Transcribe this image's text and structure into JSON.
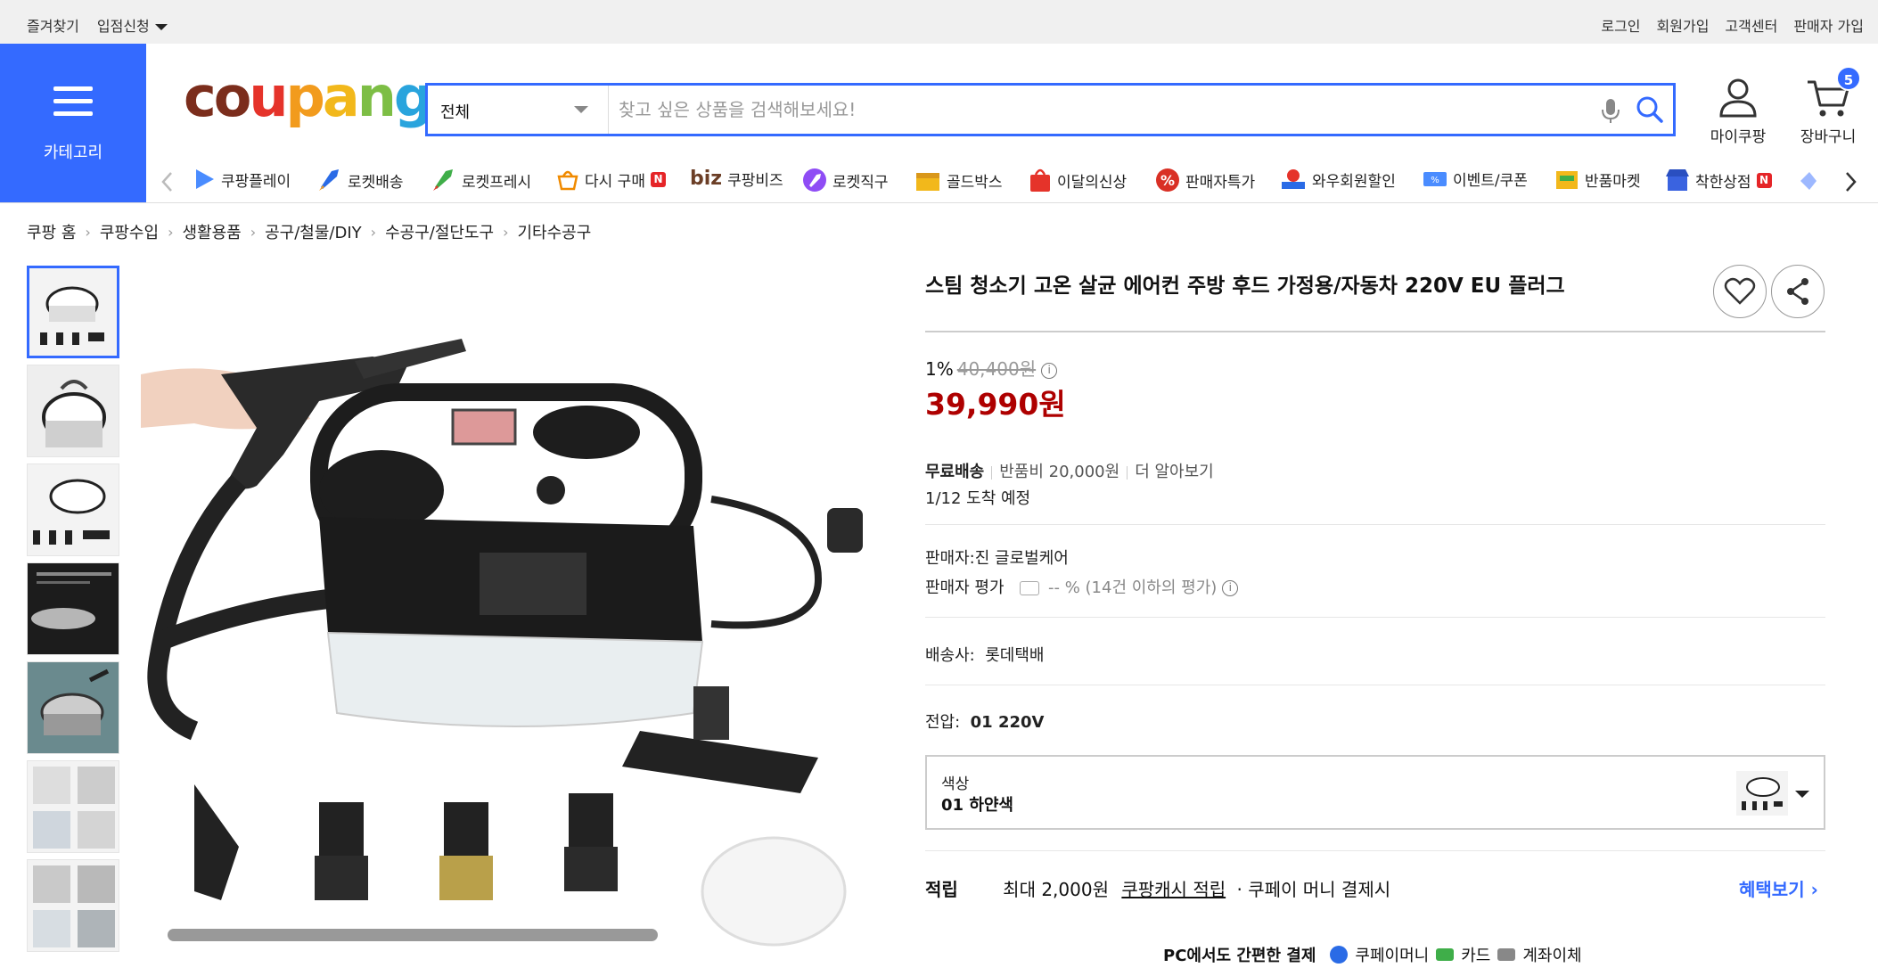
{
  "topbar": {
    "left": [
      "즐겨찾기",
      "입점신청"
    ],
    "right": [
      "로그인",
      "회원가입",
      "고객센터",
      "판매자 가입"
    ]
  },
  "category_button": {
    "label": "카테고리"
  },
  "logo": {
    "letters": [
      "c",
      "o",
      "u",
      "p",
      "a",
      "n",
      "g"
    ]
  },
  "search": {
    "category": "전체",
    "placeholder": "찾고 싶은 상품을 검색해보세요!"
  },
  "header_icons": {
    "mypage": "마이쿠팡",
    "cart": "장바구니",
    "cart_count": "5"
  },
  "nav": [
    {
      "label": "쿠팡플레이",
      "icon": "play-icon",
      "color": "#4a8cff"
    },
    {
      "label": "로켓배송",
      "icon": "rocket-icon",
      "color": "#2a6be6"
    },
    {
      "label": "로켓프레시",
      "icon": "rocket-fresh-icon",
      "color": "#3fae49"
    },
    {
      "label": "다시 구매",
      "icon": "basket-icon",
      "color": "#f08a00",
      "new": "N"
    },
    {
      "label": "쿠팡비즈",
      "icon": "biz-icon",
      "prefix": "biz",
      "color": "#6b3e26"
    },
    {
      "label": "로켓직구",
      "icon": "rocket-global-icon",
      "color": "#8f4cf5"
    },
    {
      "label": "골드박스",
      "icon": "goldbox-icon",
      "color": "#f2b81b"
    },
    {
      "label": "이달의신상",
      "icon": "shopping-bag-icon",
      "color": "#e5332a"
    },
    {
      "label": "판매자특가",
      "icon": "percent-icon",
      "color": "#d93025"
    },
    {
      "label": "와우회원할인",
      "icon": "wow-icon",
      "color": "#e5332a"
    },
    {
      "label": "이벤트/쿠폰",
      "icon": "coupon-icon",
      "color": "#4a8cff"
    },
    {
      "label": "반품마켓",
      "icon": "return-market-icon",
      "color": "#f2b81b"
    },
    {
      "label": "착한상점",
      "icon": "store-icon",
      "color": "#3a63e0",
      "new": "N"
    }
  ],
  "breadcrumb": [
    "쿠팡 홈",
    "쿠팡수입",
    "생활용품",
    "공구/철물/DIY",
    "수공구/절단도구",
    "기타수공구"
  ],
  "product": {
    "title": "스팀 청소기 고온 살균 에어컨 주방 후드 가정용/자동차 220V EU 플러그",
    "discount_rate": "1%",
    "original_price": "40,400원",
    "price": "39,990원",
    "shipping_label": "무료배송",
    "return_fee": "반품비 20,000원",
    "learn_more": "더 알아보기",
    "arrival": "1/12 도착 예정",
    "seller": "판매자:진 글로벌케어",
    "seller_rating_label": "판매자 평가",
    "seller_rating_value": "-- % (14건 이하의 평가)",
    "carrier_label": "배송사:",
    "carrier": "롯데택배",
    "voltage_label": "전압:",
    "voltage": "01 220V",
    "color_label": "색상",
    "color_value": "01 하얀색",
    "points_label": "적립",
    "points_text": "최대 2,000원",
    "points_link": "쿠팡캐시 적립",
    "points_suffix": "· 쿠페이 머니 결제시",
    "benefit_link": "혜택보기",
    "pay_title": "PC에서도 간편한 결제",
    "pay_methods": [
      "쿠페이머니",
      "카드",
      "계좌이체"
    ]
  }
}
